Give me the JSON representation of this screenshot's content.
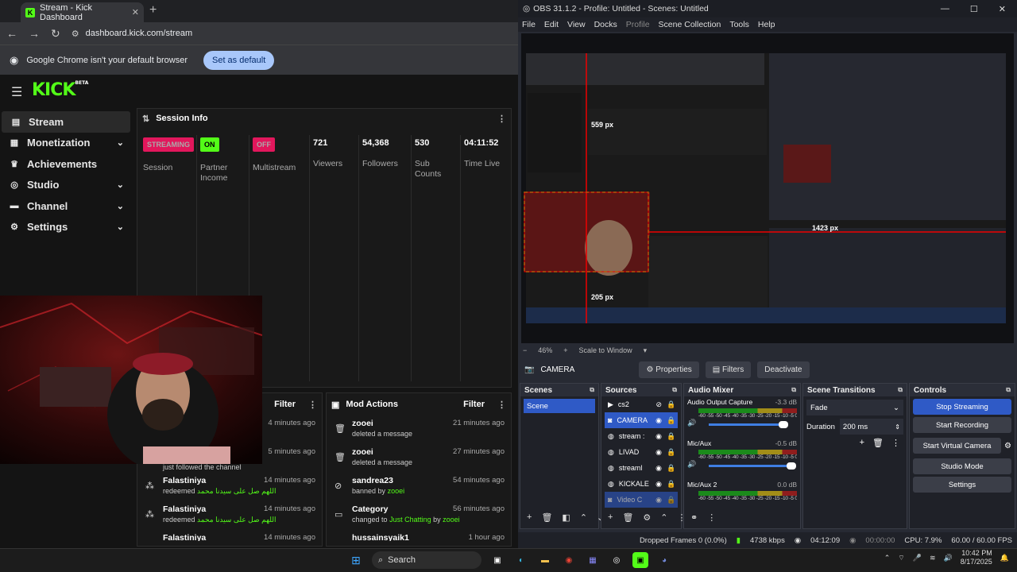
{
  "chrome": {
    "tab_title": "Stream - Kick Dashboard",
    "url": "dashboard.kick.com/stream",
    "infobar_text": "Google Chrome isn't your default browser",
    "set_default_label": "Set as default"
  },
  "kick": {
    "logo": "KICK",
    "beta": "BETA",
    "sidebar": [
      {
        "label": "Stream",
        "icon": "stream-icon"
      },
      {
        "label": "Monetization",
        "icon": "monetization-icon"
      },
      {
        "label": "Achievements",
        "icon": "trophy-icon"
      },
      {
        "label": "Studio",
        "icon": "studio-icon"
      },
      {
        "label": "Channel",
        "icon": "channel-icon"
      },
      {
        "label": "Settings",
        "icon": "gear-icon"
      }
    ],
    "session": {
      "title": "Session Info",
      "stats": [
        {
          "badge": "STREAMING",
          "badge_color": "#e2175c",
          "label": "Session"
        },
        {
          "badge": "ON",
          "badge_color": "#53fc18",
          "label": "Partner Income"
        },
        {
          "badge": "OFF",
          "badge_color": "#e2175c",
          "label": "Multistream"
        },
        {
          "value": "721",
          "label": "Viewers"
        },
        {
          "value": "54,368",
          "label": "Followers"
        },
        {
          "value": "530",
          "label": "Sub Counts"
        },
        {
          "value": "04:11:52",
          "label": "Time Live"
        }
      ]
    },
    "chat": {
      "filter_label": "Filter",
      "rows": [
        {
          "time": "4 minutes ago"
        },
        {
          "sub": "just followed the channel",
          "time": "5 minutes ago"
        },
        {
          "name": "Falastiniya",
          "sub_prefix": "redeemed",
          "sub_green": "اللهم صل على سيدنا محمد",
          "time": "14 minutes ago"
        },
        {
          "name": "Falastiniya",
          "sub_prefix": "redeemed",
          "sub_green": "اللهم صل على سيدنا محمد",
          "time": "14 minutes ago"
        },
        {
          "name": "Falastiniya",
          "time": "14 minutes ago"
        }
      ]
    },
    "mod": {
      "title": "Mod Actions",
      "filter_label": "Filter",
      "rows": [
        {
          "name": "zooei",
          "sub": "deleted a message",
          "time": "21 minutes ago"
        },
        {
          "name": "zooei",
          "sub": "deleted a message",
          "time": "27 minutes ago"
        },
        {
          "name": "sandrea23",
          "sub": "banned by",
          "sub_green": "zooei",
          "time": "54 minutes ago"
        },
        {
          "name": "Category",
          "sub": "changed to",
          "sub_green": "Just Chatting",
          "sub_tail": "by",
          "sub_green2": "zooei",
          "time": "56 minutes ago"
        },
        {
          "name": "hussainsyaik1",
          "time": "1 hour ago"
        }
      ]
    }
  },
  "obs": {
    "title": "OBS 31.1.2 - Profile: Untitled - Scenes: Untitled",
    "menu": [
      "File",
      "Edit",
      "View",
      "Docks",
      "Profile",
      "Scene Collection",
      "Tools",
      "Help"
    ],
    "zoom": "46%",
    "scale_mode": "Scale to Window",
    "preview_labels": {
      "px1": "559 px",
      "px2": "1423 px",
      "px3": "205 px"
    },
    "selected_source": "CAMERA",
    "source_buttons": [
      "Properties",
      "Filters",
      "Deactivate"
    ],
    "docks": {
      "scenes": "Scenes",
      "sources": "Sources",
      "mixer": "Audio Mixer",
      "transitions": "Scene Transitions",
      "controls": "Controls"
    },
    "scenes": [
      "Scene"
    ],
    "sources": [
      "cs2",
      "CAMERA",
      "stream :",
      "LIVAD",
      "streaml",
      "KICKALE",
      "Video C"
    ],
    "mixer": [
      {
        "name": "Audio Output Capture",
        "db": "-3.3 dB"
      },
      {
        "name": "Mic/Aux",
        "db": "-0.5 dB"
      },
      {
        "name": "Mic/Aux 2",
        "db": "0.0 dB"
      }
    ],
    "tick_labels": "-60 -55 -50 -45 -40 -35 -30 -25 -20 -15 -10 -5 0",
    "transition": "Fade",
    "duration_label": "Duration",
    "duration_value": "200 ms",
    "controls": [
      "Stop Streaming",
      "Start Recording",
      "Start Virtual Camera",
      "Studio Mode",
      "Settings"
    ],
    "status": {
      "dropped": "Dropped Frames 0 (0.0%)",
      "kbps": "4738 kbps",
      "live_time": "04:12:09",
      "rec_time": "00:00:00",
      "cpu": "CPU: 7.9%",
      "fps": "60.00 / 60.00 FPS"
    }
  },
  "taskbar": {
    "search_label": "Search",
    "time": "10:42 PM",
    "date": "8/17/2025"
  }
}
